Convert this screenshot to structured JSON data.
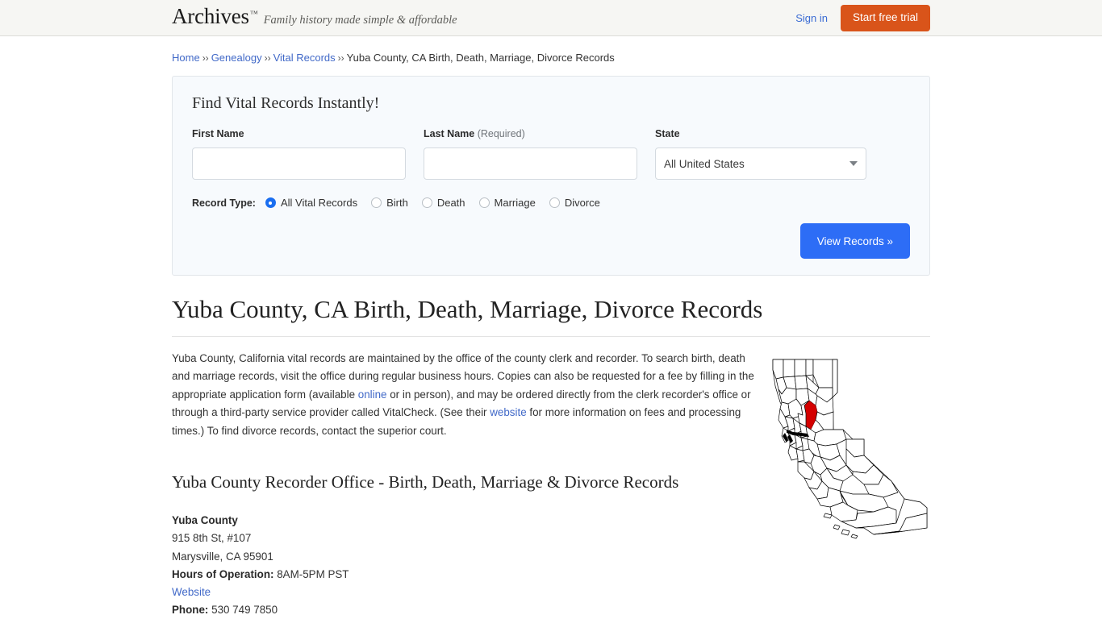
{
  "header": {
    "brand_name": "Archives",
    "brand_tm": "™",
    "tagline": "Family history made simple & affordable",
    "signin_label": "Sign in",
    "trial_label": "Start free trial",
    "accent_orange": "#d9541a",
    "link_blue": "#3b6cd4"
  },
  "breadcrumb": {
    "items": [
      {
        "label": "Home",
        "link": true
      },
      {
        "label": "Genealogy",
        "link": true
      },
      {
        "label": "Vital Records",
        "link": true
      },
      {
        "label": "Yuba County, CA Birth, Death, Marriage, Divorce Records",
        "link": false
      }
    ],
    "separator": "››"
  },
  "search_panel": {
    "title": "Find Vital Records Instantly!",
    "first_name": {
      "label": "First Name",
      "value": "",
      "placeholder": ""
    },
    "last_name": {
      "label": "Last Name",
      "required_note": "(Required)",
      "value": "",
      "placeholder": ""
    },
    "state": {
      "label": "State",
      "selected": "All United States",
      "chevron_icon": "chevron-down-icon"
    },
    "record_type": {
      "label": "Record Type:",
      "options": [
        {
          "label": "All Vital Records",
          "checked": true
        },
        {
          "label": "Birth",
          "checked": false
        },
        {
          "label": "Death",
          "checked": false
        },
        {
          "label": "Marriage",
          "checked": false
        },
        {
          "label": "Divorce",
          "checked": false
        }
      ]
    },
    "submit_label": "View Records »",
    "submit_color": "#2d6df6"
  },
  "main": {
    "h1": "Yuba County, CA Birth, Death, Marriage, Divorce Records",
    "paragraph": {
      "part1": "Yuba County, California vital records are maintained by the office of the county clerk and recorder. To search birth, death and marriage records, visit the office during regular business hours. Copies can also be requested for a fee by filling in the appropriate application form (available ",
      "link1": "online",
      "part2": " or in person), and may be ordered directly from the clerk recorder's office or through a third-party service provider called VitalCheck. (See their ",
      "link2": "website",
      "part3": " for more information on fees and processing times.) To find divorce records, contact the superior court."
    },
    "sub_heading": "Yuba County Recorder Office - Birth, Death, Marriage & Divorce Records",
    "office": {
      "name": "Yuba County",
      "street": "915 8th St, #107",
      "city_state_zip": "Marysville, CA 95901",
      "hours_label": "Hours of Operation:",
      "hours_value": "8AM-5PM PST",
      "website_label": "Website",
      "phone_label": "Phone:",
      "phone_value": "530 749 7850"
    },
    "map": {
      "name": "california-county-map",
      "highlight_county": "Yuba",
      "highlight_color": "#d40000",
      "outline_color": "#000000"
    }
  }
}
